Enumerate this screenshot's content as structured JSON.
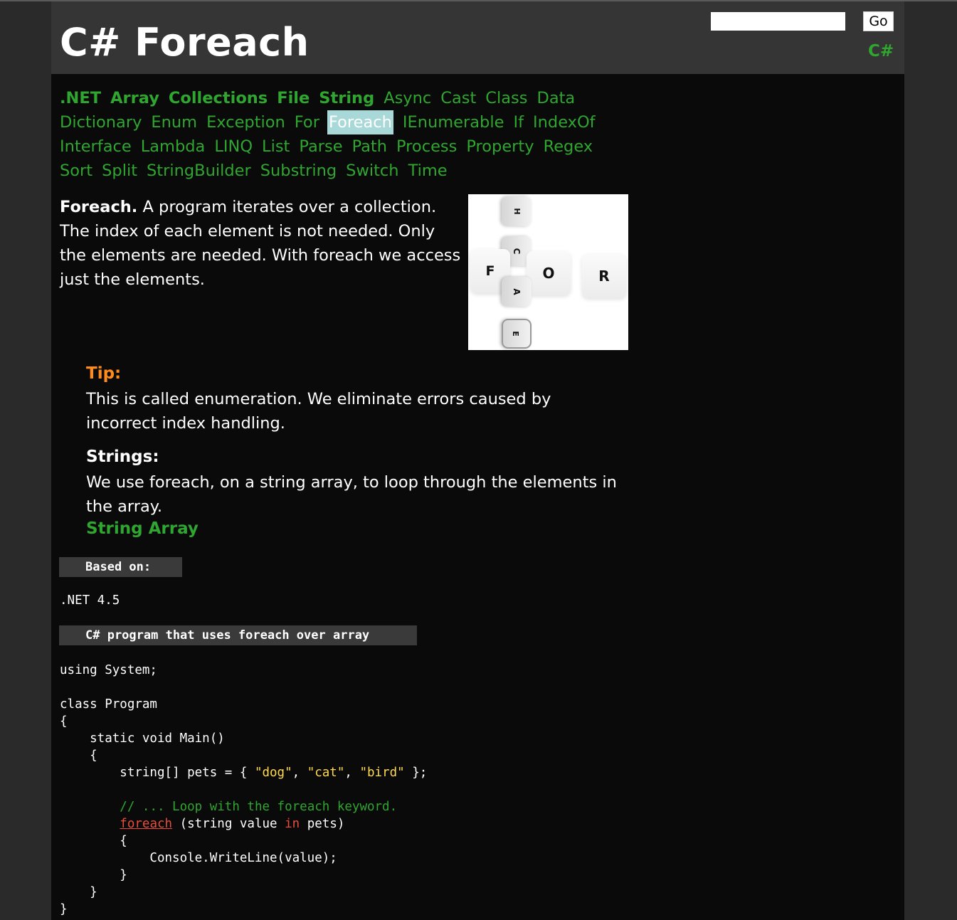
{
  "header": {
    "title": "C# Foreach",
    "search_placeholder": "",
    "go_label": "Go",
    "site_tag": "C#"
  },
  "nav": {
    "rows": [
      [
        ".NET",
        "Array",
        "Collections",
        "File",
        "String",
        "Async",
        "Cast",
        "Class",
        "Data"
      ],
      [
        "Dictionary",
        "Enum",
        "Exception",
        "For",
        "Foreach",
        "IEnumerable",
        "If",
        "IndexOf"
      ],
      [
        "Interface",
        "Lambda",
        "LINQ",
        "List",
        "Parse",
        "Path",
        "Process",
        "Property",
        "Regex"
      ],
      [
        "Sort",
        "Split",
        "StringBuilder",
        "Substring",
        "Switch",
        "Time"
      ]
    ],
    "bold_items": [
      ".NET",
      "Array",
      "Collections",
      "File",
      "String"
    ],
    "active_item": "Foreach"
  },
  "intro": {
    "lead": "Foreach.",
    "text": " A program iterates over a collection. The index of each element is not needed. Only the elements are needed. With foreach we access just the elements."
  },
  "keyboard_image": {
    "keys": [
      "H",
      "C",
      "F",
      "O",
      "R",
      "A",
      "E"
    ]
  },
  "tip": {
    "label": "Tip:",
    "text": "This is called enumeration. We eliminate errors caused by incorrect index handling."
  },
  "strings": {
    "label": "Strings:",
    "text": "We use foreach, on a string array, to loop through the elements in the array.",
    "link": "String Array"
  },
  "based_on": {
    "label": "Based on:",
    "value": ".NET 4.5"
  },
  "program": {
    "label": "C# program that uses foreach over array",
    "line1": "using System;",
    "line2": "class Program",
    "line3": "{",
    "line4": "    static void Main()",
    "line5": "    {",
    "line6_pre": "        string[] pets = { ",
    "str_dog": "\"dog\"",
    "sep1": ", ",
    "str_cat": "\"cat\"",
    "sep2": ", ",
    "str_bird": "\"bird\"",
    "line6_post": " };",
    "comment_indent": "        ",
    "comment": "// ... Loop with the foreach keyword.",
    "foreach_indent": "        ",
    "kw_foreach": "foreach",
    "foreach_mid": " (string value ",
    "kw_in": "in",
    "foreach_post": " pets)",
    "line9": "        {",
    "line10": "            Console.WriteLine(value);",
    "line11": "        }",
    "line12": "    }",
    "line13": "}"
  },
  "colors": {
    "link_green": "#2fa62f",
    "tip_orange": "#ff8c1a",
    "active_nav_bg": "#a9d8d8",
    "string_literal": "#ffd94a",
    "keyword_red": "#e84c3d"
  }
}
